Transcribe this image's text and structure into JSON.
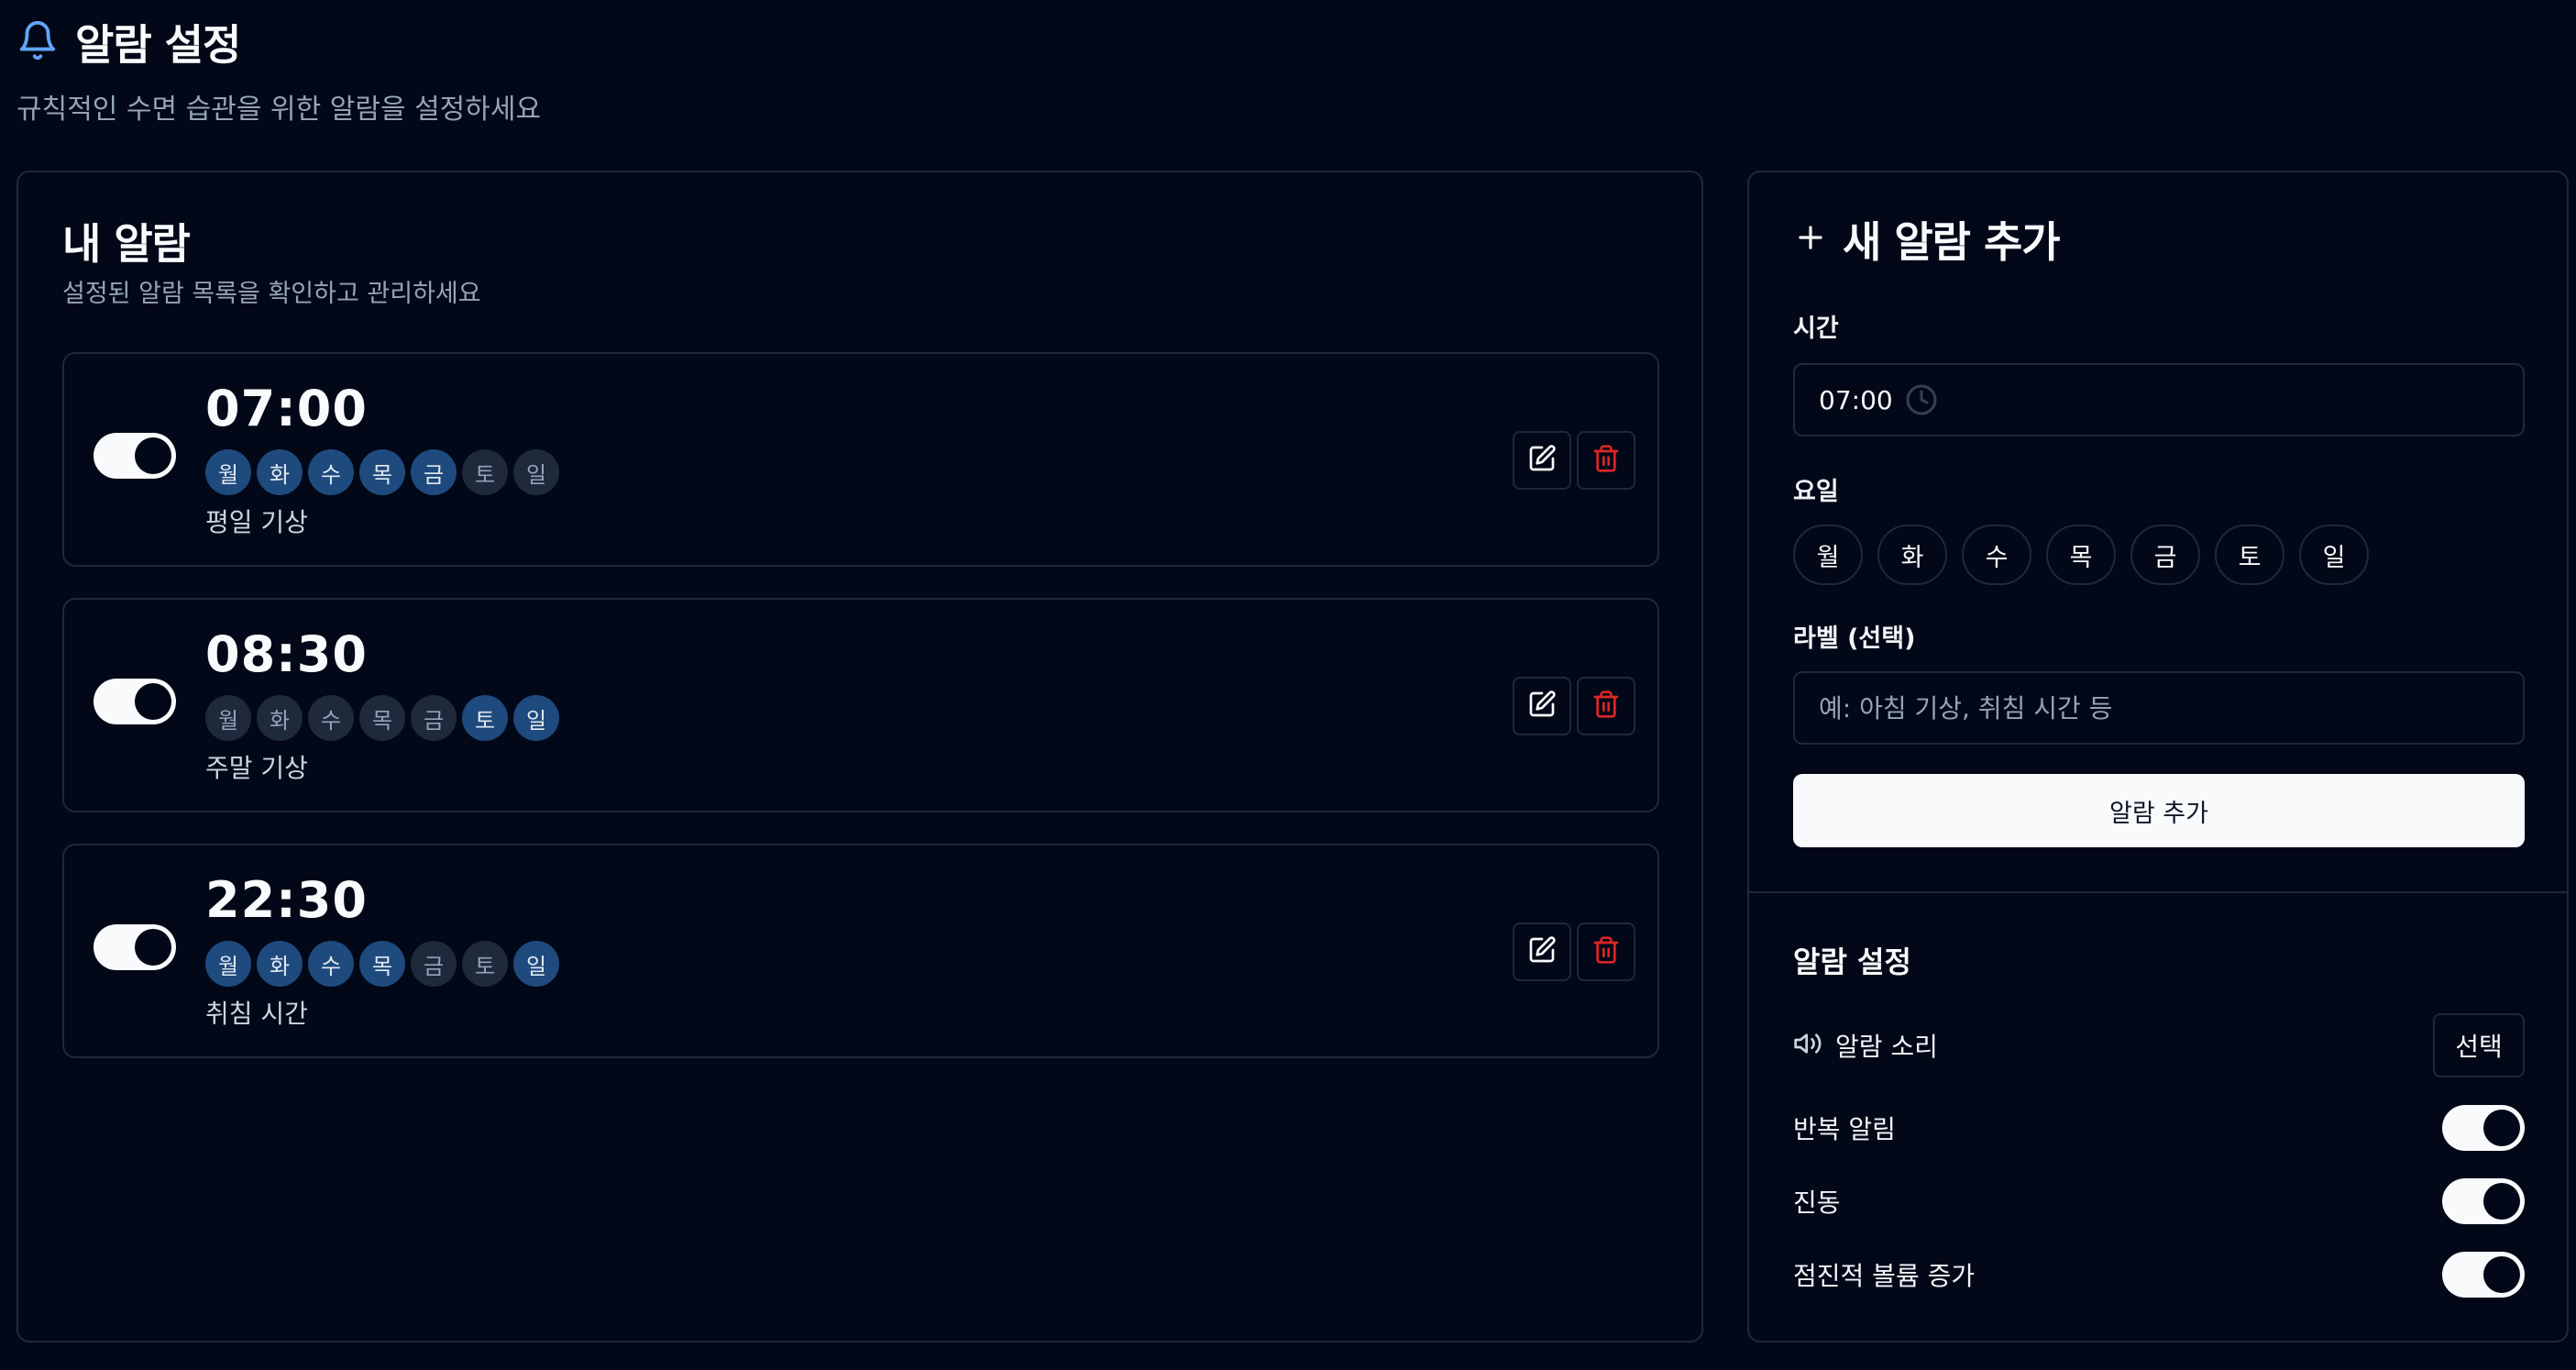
{
  "header": {
    "title": "알람 설정",
    "subtitle": "규칙적인 수면 습관을 위한 알람을 설정하세요",
    "icon": "bell-icon"
  },
  "alarms_panel": {
    "title": "내 알람",
    "description": "설정된 알람 목록을 확인하고 관리하세요",
    "alarms": [
      {
        "time": "07:00",
        "enabled": true,
        "label": "평일 기상",
        "days": [
          {
            "name": "월",
            "active": true
          },
          {
            "name": "화",
            "active": true
          },
          {
            "name": "수",
            "active": true
          },
          {
            "name": "목",
            "active": true
          },
          {
            "name": "금",
            "active": true
          },
          {
            "name": "토",
            "active": false
          },
          {
            "name": "일",
            "active": false
          }
        ]
      },
      {
        "time": "08:30",
        "enabled": true,
        "label": "주말 기상",
        "days": [
          {
            "name": "월",
            "active": false
          },
          {
            "name": "화",
            "active": false
          },
          {
            "name": "수",
            "active": false
          },
          {
            "name": "목",
            "active": false
          },
          {
            "name": "금",
            "active": false
          },
          {
            "name": "토",
            "active": true
          },
          {
            "name": "일",
            "active": true
          }
        ]
      },
      {
        "time": "22:30",
        "enabled": true,
        "label": "취침 시간",
        "days": [
          {
            "name": "월",
            "active": true
          },
          {
            "name": "화",
            "active": true
          },
          {
            "name": "수",
            "active": true
          },
          {
            "name": "목",
            "active": true
          },
          {
            "name": "금",
            "active": false
          },
          {
            "name": "토",
            "active": false
          },
          {
            "name": "일",
            "active": true
          }
        ]
      }
    ]
  },
  "add_panel": {
    "title": "새 알람 추가",
    "time_label": "시간",
    "time_value": "07:00",
    "days_label": "요일",
    "days": [
      "월",
      "화",
      "수",
      "목",
      "금",
      "토",
      "일"
    ],
    "label_label": "라벨 (선택)",
    "label_placeholder": "예: 아침 기상, 취침 시간 등",
    "add_button": "알람 추가"
  },
  "settings": {
    "title": "알람 설정",
    "sound_label": "알람 소리",
    "sound_button": "선택",
    "repeat_label": "반복 알림",
    "repeat_enabled": true,
    "vibration_label": "진동",
    "vibration_enabled": true,
    "volume_label": "점진적 볼륨 증가",
    "volume_enabled": true
  },
  "colors": {
    "background": "#020817",
    "border": "#1e293b",
    "accent": "#3b82f6",
    "active_day": "#1e4a7e",
    "danger": "#dc2626"
  }
}
